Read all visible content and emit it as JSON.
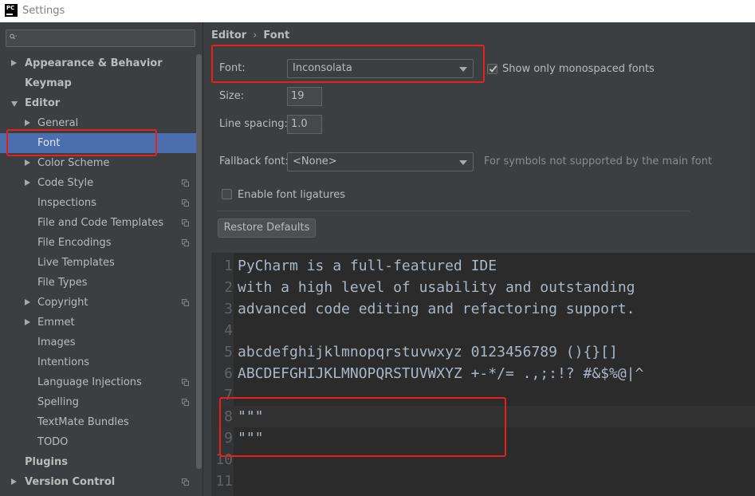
{
  "window": {
    "title": "Settings",
    "app_icon_text": "PC"
  },
  "search": {
    "placeholder": ""
  },
  "sidebar": {
    "items": [
      {
        "label": "Appearance & Behavior",
        "level": 0,
        "arrow": "right"
      },
      {
        "label": "Keymap",
        "level": 0,
        "arrow": "none"
      },
      {
        "label": "Editor",
        "level": 0,
        "arrow": "down"
      },
      {
        "label": "General",
        "level": 1,
        "arrow": "right"
      },
      {
        "label": "Font",
        "level": 1,
        "arrow": "none",
        "selected": true
      },
      {
        "label": "Color Scheme",
        "level": 1,
        "arrow": "right"
      },
      {
        "label": "Code Style",
        "level": 1,
        "arrow": "right",
        "copy_icon": true
      },
      {
        "label": "Inspections",
        "level": 1,
        "arrow": "none",
        "copy_icon": true
      },
      {
        "label": "File and Code Templates",
        "level": 1,
        "arrow": "none",
        "copy_icon": true
      },
      {
        "label": "File Encodings",
        "level": 1,
        "arrow": "none",
        "copy_icon": true
      },
      {
        "label": "Live Templates",
        "level": 1,
        "arrow": "none"
      },
      {
        "label": "File Types",
        "level": 1,
        "arrow": "none"
      },
      {
        "label": "Copyright",
        "level": 1,
        "arrow": "right",
        "copy_icon": true
      },
      {
        "label": "Emmet",
        "level": 1,
        "arrow": "right"
      },
      {
        "label": "Images",
        "level": 1,
        "arrow": "none"
      },
      {
        "label": "Intentions",
        "level": 1,
        "arrow": "none"
      },
      {
        "label": "Language Injections",
        "level": 1,
        "arrow": "none",
        "copy_icon": true
      },
      {
        "label": "Spelling",
        "level": 1,
        "arrow": "none",
        "copy_icon": true
      },
      {
        "label": "TextMate Bundles",
        "level": 1,
        "arrow": "none"
      },
      {
        "label": "TODO",
        "level": 1,
        "arrow": "none"
      },
      {
        "label": "Plugins",
        "level": 0,
        "arrow": "none"
      },
      {
        "label": "Version Control",
        "level": 0,
        "arrow": "right",
        "copy_icon": true
      }
    ]
  },
  "breadcrumb": {
    "parent": "Editor",
    "separator": "›",
    "current": "Font"
  },
  "font_settings": {
    "font_label": "Font:",
    "font_value": "Inconsolata",
    "monospaced_label": "Show only monospaced fonts",
    "monospaced_checked": true,
    "size_label": "Size:",
    "size_value": "19",
    "line_spacing_label": "Line spacing:",
    "line_spacing_value": "1.0",
    "fallback_label": "Fallback font:",
    "fallback_value": "<None>",
    "fallback_hint": "For symbols not supported by the main font",
    "ligatures_label": "Enable font ligatures",
    "ligatures_checked": false,
    "restore_button": "Restore Defaults"
  },
  "preview": {
    "lines": [
      {
        "num": "1",
        "text": "PyCharm is a full-featured IDE"
      },
      {
        "num": "2",
        "text": "with a high level of usability and outstanding"
      },
      {
        "num": "3",
        "text": "advanced code editing and refactoring support."
      },
      {
        "num": "4",
        "text": ""
      },
      {
        "num": "5",
        "text": "abcdefghijklmnopqrstuvwxyz 0123456789 (){}[]"
      },
      {
        "num": "6",
        "text": "ABCDEFGHIJKLMNOPQRSTUVWXYZ +-*/= .,;:!? #&$%@|^"
      },
      {
        "num": "7",
        "text": ""
      },
      {
        "num": "8",
        "text": "\"\"\"",
        "current": true
      },
      {
        "num": "9",
        "text": "\"\"\""
      },
      {
        "num": "10",
        "text": ""
      },
      {
        "num": "11",
        "text": ""
      }
    ]
  },
  "colors": {
    "selection": "#4b6eaf",
    "annotation_red": "#e8201a",
    "background": "#3c3f41",
    "editor_background": "#2b2b2b"
  }
}
